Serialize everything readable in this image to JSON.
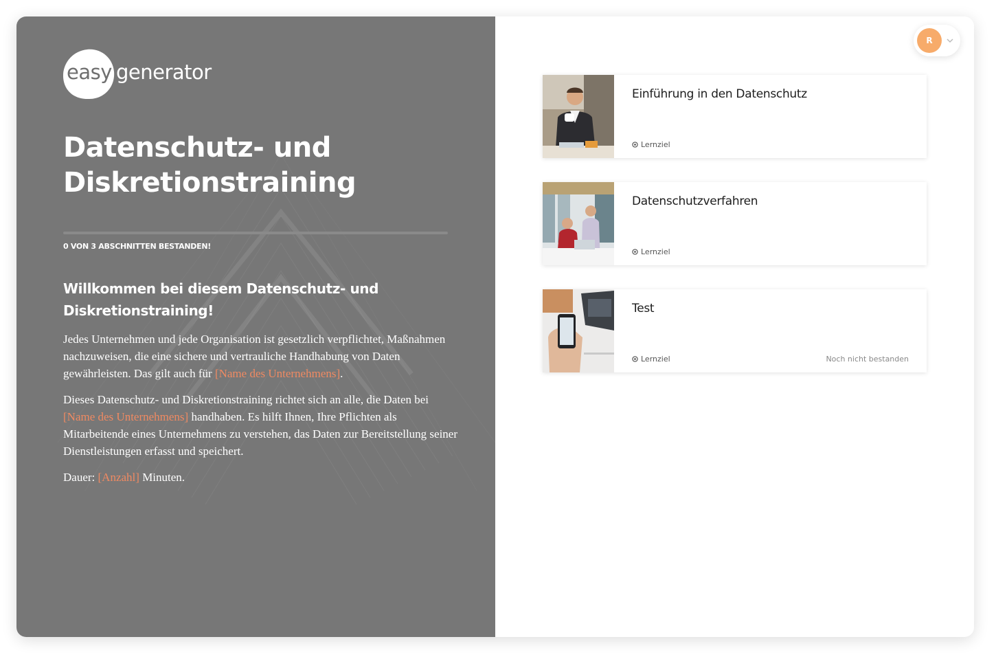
{
  "logo": {
    "word1": "easy",
    "word2": "generator"
  },
  "course": {
    "title_line1": "Datenschutz- und",
    "title_line2": "Diskretionstraining",
    "progress_fraction": 0,
    "progress_label": "0 VON 3 ABSCHNITTEN BESTANDEN!"
  },
  "intro": {
    "heading_line1": "Willkommen bei diesem Datenschutz- und",
    "heading_line2": "Diskretionstraining!",
    "p1_text": "Jedes Unternehmen und jede Organisation ist gesetzlich verpflichtet, Maßnahmen nachzuweisen, die eine sichere und vertrauliche Handhabung von Daten gewährleisten. Das gilt auch für ",
    "p1_placeholder": "[Name des Unternehmens]",
    "p1_end": ".",
    "p2_placeholder": "[Name des Unternehmens]",
    "p2_start": "Dieses Datenschutz- und Diskretionstraining richtet sich an alle, die Daten bei ",
    "p2_text": " handhaben. Es hilft Ihnen, Ihre Pflichten als Mitarbeitende eines Unternehmens zu verstehen, das Daten zur Bereitstellung seiner Dienstleistungen erfasst und speichert.",
    "p3_start": "Dauer: ",
    "p3_placeholder": "[Anzahl]",
    "p3_end": " Minuten."
  },
  "user": {
    "initial": "R"
  },
  "sections": [
    {
      "title": "Einführung in den Datenschutz",
      "meta": "Lernziel",
      "status": ""
    },
    {
      "title": "Datenschutzverfahren",
      "meta": "Lernziel",
      "status": ""
    },
    {
      "title": "Test",
      "meta": "Lernziel",
      "status": "Noch nicht bestanden"
    }
  ],
  "colors": {
    "panel": "#777777",
    "placeholder": "#f08a62",
    "avatar": "#f7ab6a"
  }
}
